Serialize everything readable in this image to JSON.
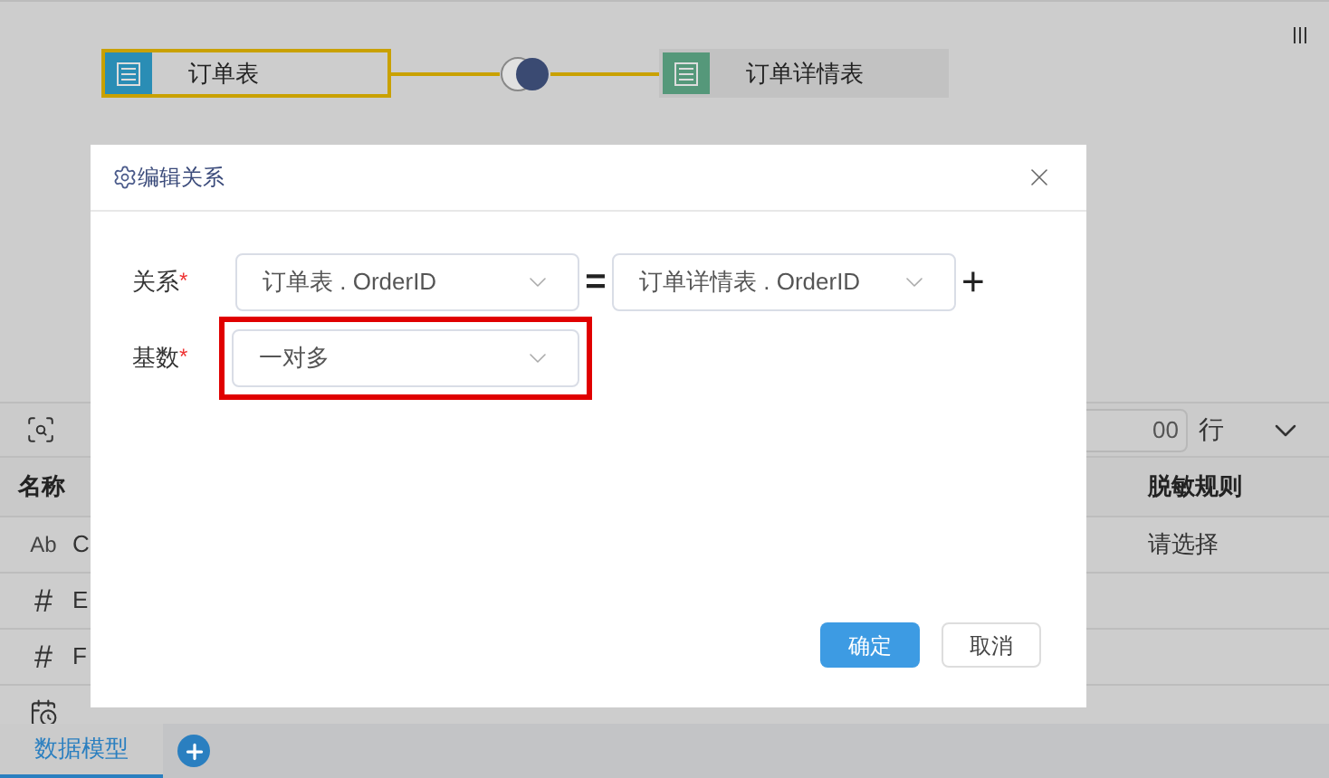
{
  "canvas": {
    "tables": [
      {
        "name": "订单表",
        "selected": true,
        "color": "#2a8db5"
      },
      {
        "name": "订单详情表",
        "selected": false,
        "color": "#55987a"
      }
    ]
  },
  "toolbar": {
    "rows_input": {
      "value": "00"
    },
    "unit": "行"
  },
  "table": {
    "columns": [
      "名称",
      "脱敏规则"
    ],
    "rows": [
      {
        "kind": "text",
        "type_label": "Ab",
        "name": "C",
        "masking": "请选择"
      },
      {
        "kind": "number",
        "type_label": "#",
        "name": "E"
      },
      {
        "kind": "number",
        "type_label": "#",
        "name": "F"
      },
      {
        "kind": "date"
      }
    ]
  },
  "bottom_tabs": [
    {
      "label": "数据模型",
      "selected": true
    }
  ],
  "dialog": {
    "title": "编辑关系",
    "relation": {
      "label": "关系",
      "required_mark": "*",
      "left": "订单表 . OrderID",
      "operator": "=",
      "right": "订单详情表 . OrderID",
      "add": "+"
    },
    "cardinality": {
      "label": "基数",
      "required_mark": "*",
      "value": "一对多",
      "highlighted": true
    },
    "buttons": [
      {
        "label": "确定",
        "kind": "primary"
      },
      {
        "label": "取消",
        "kind": "default"
      }
    ]
  }
}
